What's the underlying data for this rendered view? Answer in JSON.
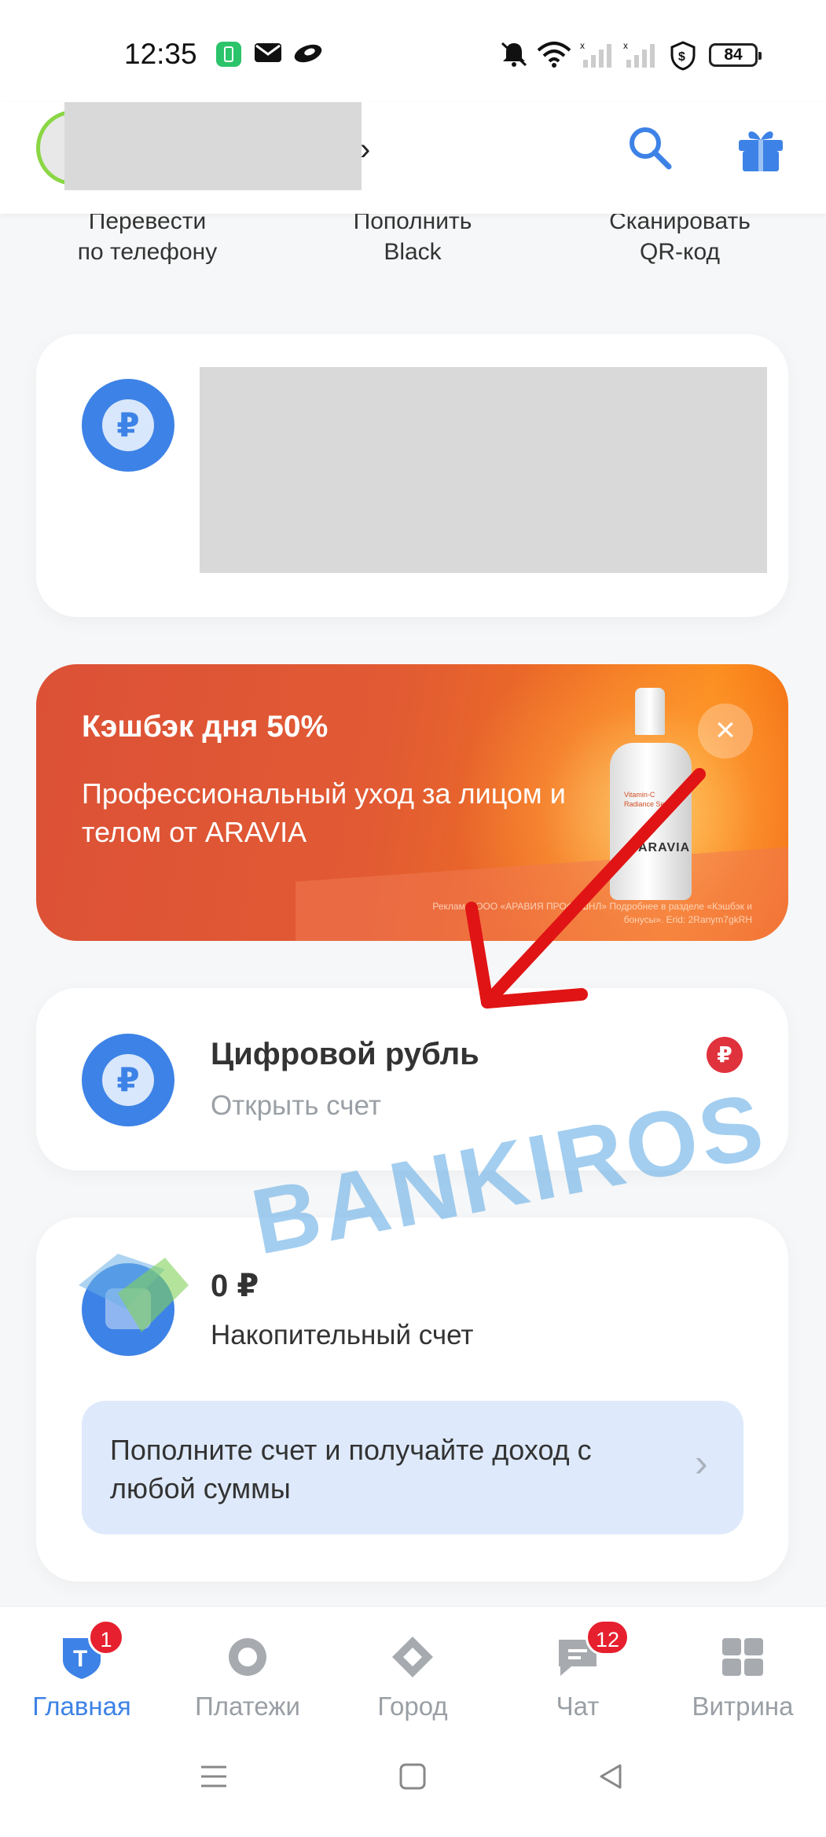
{
  "status_bar": {
    "time": "12:35",
    "battery": "84",
    "icons": [
      "battery-saver-icon",
      "mail-icon",
      "app-notification-icon",
      "mute-icon",
      "wifi-icon",
      "signal-icon",
      "vpn-shield-icon"
    ]
  },
  "header": {
    "icons": [
      "avatar",
      "search-icon",
      "gift-icon"
    ]
  },
  "quick_actions": [
    {
      "label": "Перевести\nпо телефону"
    },
    {
      "label": "Пополнить\nBlack"
    },
    {
      "label": "Сканировать\nQR-код"
    }
  ],
  "banner": {
    "title": "Кэшбэк дня 50%",
    "text": "Профессиональный уход за лицом и телом от ARAVIA",
    "legal": "Реклама. ООО «АРАВИЯ ПРОФЕШНЛ» Подробнее в разделе «Кэшбэк и бонусы». Erid: 2Ranym7gkRH",
    "bottle_label": "Vitamin-C Radiance Serum",
    "bottle_brand": "ARAVIA"
  },
  "digital_ruble": {
    "title": "Цифровой рубль",
    "subtitle": "Открыть счет",
    "symbol": "₽"
  },
  "savings": {
    "amount": "0 ₽",
    "label": "Накопительный счет",
    "promo": "Пополните счет и получайте доход с любой суммы"
  },
  "watermark": "BANKIROS",
  "bottom_nav": [
    {
      "label": "Главная",
      "badge": "1",
      "active": true
    },
    {
      "label": "Платежи",
      "badge": ""
    },
    {
      "label": "Город",
      "badge": ""
    },
    {
      "label": "Чат",
      "badge": "12"
    },
    {
      "label": "Витрина",
      "badge": ""
    }
  ],
  "colors": {
    "accent": "#3d82e6",
    "badge_red": "#e6202e",
    "banner": "#e15a34",
    "promo_bg": "#deeafb"
  }
}
